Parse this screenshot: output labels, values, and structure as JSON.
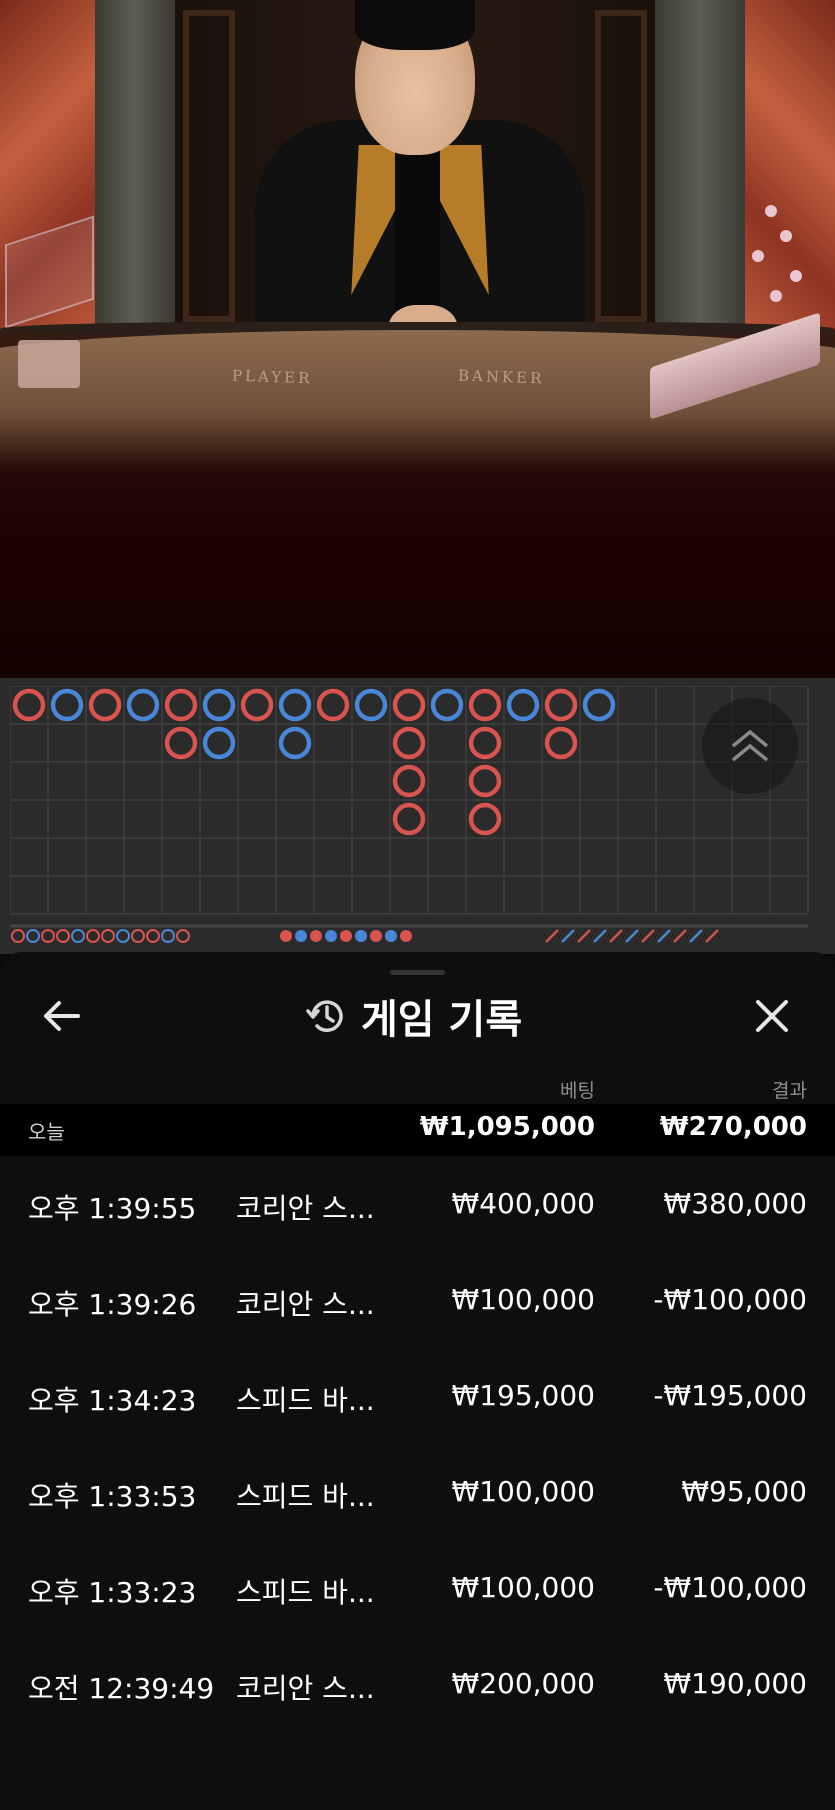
{
  "video": {
    "table_label_player": "PLAYER",
    "table_label_banker": "BANKER"
  },
  "roadmap": {
    "colors": {
      "banker": "#d9534f",
      "player": "#4a86d8",
      "grid_line": "#3f3f3f",
      "background": "#2b2b2b"
    },
    "big_road_columns": [
      [
        "B"
      ],
      [
        "P"
      ],
      [
        "B"
      ],
      [
        "P"
      ],
      [
        "B",
        "B"
      ],
      [
        "P",
        "P"
      ],
      [
        "B"
      ],
      [
        "P",
        "P"
      ],
      [
        "B"
      ],
      [
        "P"
      ],
      [
        "B",
        "B",
        "B",
        "B"
      ],
      [
        "P"
      ],
      [
        "B",
        "B",
        "B",
        "B"
      ],
      [
        "P"
      ],
      [
        "B",
        "B"
      ],
      [
        "P"
      ]
    ],
    "scroll_up_icon": "double-chevron-up-icon"
  },
  "sheet": {
    "back_icon": "arrow-left-icon",
    "history_icon": "history-icon",
    "close_icon": "close-icon",
    "title": "게임 기록",
    "col_bet": "베팅",
    "col_result": "결과",
    "summary": {
      "label": "오늘",
      "bet": "₩1,095,000",
      "result": "₩270,000"
    },
    "rows": [
      {
        "time": "오후 1:39:55",
        "game": "코리안 스...",
        "bet": "₩400,000",
        "result": "₩380,000"
      },
      {
        "time": "오후 1:39:26",
        "game": "코리안 스...",
        "bet": "₩100,000",
        "result": "-₩100,000"
      },
      {
        "time": "오후 1:34:23",
        "game": "스피드 바...",
        "bet": "₩195,000",
        "result": "-₩195,000"
      },
      {
        "time": "오후 1:33:53",
        "game": "스피드 바...",
        "bet": "₩100,000",
        "result": "₩95,000"
      },
      {
        "time": "오후 1:33:23",
        "game": "스피드 바...",
        "bet": "₩100,000",
        "result": "-₩100,000"
      },
      {
        "time": "오전 12:39:49",
        "game": "코리안 스...",
        "bet": "₩200,000",
        "result": "₩190,000"
      }
    ]
  }
}
